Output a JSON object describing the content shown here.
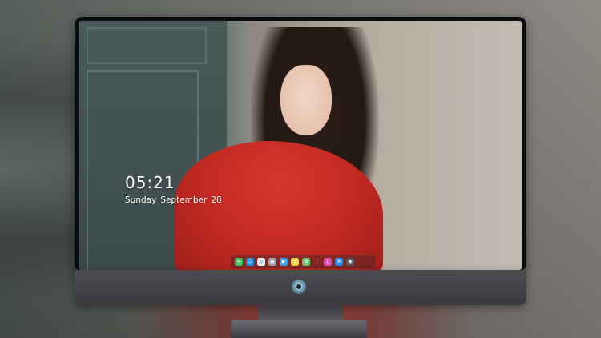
{
  "lockscreen": {
    "time": "05:21",
    "date_weekday": "Sunday",
    "date_month": "September",
    "date_day": "28"
  },
  "dock": {
    "apps": [
      {
        "name": "messages-icon",
        "glyph": "✉",
        "color": "#34c759"
      },
      {
        "name": "finder-icon",
        "glyph": "☺",
        "color": "#1e88e5"
      },
      {
        "name": "safari-icon",
        "glyph": "◎",
        "color": "#f5f5f5"
      },
      {
        "name": "preview-icon",
        "glyph": "▣",
        "color": "#9aa3ad"
      },
      {
        "name": "final-cut-icon",
        "glyph": "▶",
        "color": "#3aa3e8"
      },
      {
        "name": "notes-icon",
        "glyph": "≡",
        "color": "#f7d046"
      },
      {
        "name": "photos-icon",
        "glyph": "✿",
        "color": "#6ac46a"
      },
      {
        "name": "itunes-icon",
        "glyph": "♫",
        "color": "#e34fb4"
      },
      {
        "name": "app-store-icon",
        "glyph": "A",
        "color": "#2a8cf0"
      },
      {
        "name": "camera-icon",
        "glyph": "◉",
        "color": "#55595f"
      }
    ]
  },
  "colors": {
    "bezel": "#0d0d0f",
    "chin": "#4d4d51",
    "wallpaper_red": "#c22a22"
  }
}
